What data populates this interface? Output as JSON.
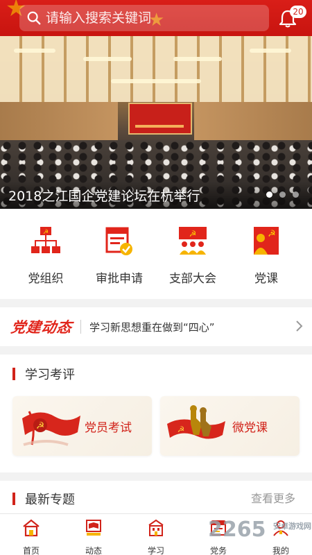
{
  "search": {
    "placeholder": "请输入搜索关键词"
  },
  "notifications": {
    "count": "20"
  },
  "banner": {
    "title": "2018之江国企党建论坛在杭举行",
    "slide_count": 3,
    "active_slide": 1
  },
  "quick_menu": [
    {
      "label": "党组织",
      "icon": "org-chart-icon"
    },
    {
      "label": "审批申请",
      "icon": "approval-icon"
    },
    {
      "label": "支部大会",
      "icon": "branch-meeting-icon"
    },
    {
      "label": "党课",
      "icon": "party-lesson-icon"
    }
  ],
  "news": {
    "logo": "党建动态",
    "headline": "学习新思想重在做到“四心”"
  },
  "study": {
    "title": "学习考评",
    "cards": [
      {
        "label": "党员考试",
        "icon": "party-flag-icon"
      },
      {
        "label": "微党课",
        "icon": "heroes-flag-icon"
      }
    ]
  },
  "topics": {
    "title": "最新专题",
    "more": "查看更多"
  },
  "tabs": [
    {
      "label": "首页",
      "icon": "home-icon"
    },
    {
      "label": "动态",
      "icon": "news-flag-icon"
    },
    {
      "label": "学习",
      "icon": "study-building-icon"
    },
    {
      "label": "党务",
      "icon": "party-affairs-icon"
    },
    {
      "label": "我的",
      "icon": "profile-icon"
    }
  ],
  "watermark": {
    "text": "2265",
    "sub": "安卓游戏网"
  },
  "colors": {
    "brand_red": "#d1231a",
    "accent_gold": "#f6b400"
  }
}
